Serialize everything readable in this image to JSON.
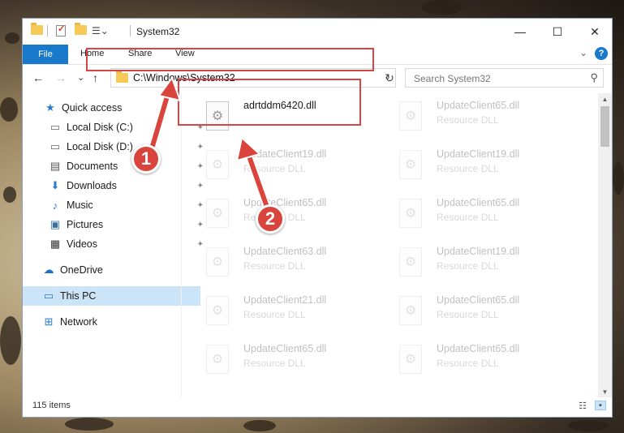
{
  "window": {
    "title": "System32",
    "minimize_glyph": "—",
    "maximize_glyph": "☐",
    "close_glyph": "✕"
  },
  "ribbon": {
    "file_tab": "File",
    "tabs": [
      "Home",
      "Share",
      "View"
    ],
    "help_glyph": "?",
    "expand_glyph": "⌄"
  },
  "address": {
    "path": "C:\\Windows\\System32",
    "dropdown_glyph": "⌄",
    "refresh_glyph": "↻"
  },
  "search": {
    "placeholder": "Search System32",
    "icon": "search-icon"
  },
  "nav_buttons": {
    "back": "←",
    "forward": "→",
    "recent": "⌄",
    "up": "↑"
  },
  "sidebar": {
    "items": [
      {
        "label": "Quick access",
        "icon": "star-icon",
        "glyph": "★",
        "pinned": false,
        "indent": 0
      },
      {
        "label": "Local Disk (C:)",
        "icon": "drive-icon",
        "glyph": "▭",
        "pinned": true,
        "indent": 1
      },
      {
        "label": "Local Disk (D:)",
        "icon": "drive-icon",
        "glyph": "▭",
        "pinned": true,
        "indent": 1
      },
      {
        "label": "Documents",
        "icon": "documents-icon",
        "glyph": "▤",
        "pinned": true,
        "indent": 1
      },
      {
        "label": "Downloads",
        "icon": "downloads-icon",
        "glyph": "⬇",
        "pinned": true,
        "indent": 1
      },
      {
        "label": "Music",
        "icon": "music-icon",
        "glyph": "♪",
        "pinned": true,
        "indent": 1
      },
      {
        "label": "Pictures",
        "icon": "pictures-icon",
        "glyph": "▣",
        "pinned": true,
        "indent": 1
      },
      {
        "label": "Videos",
        "icon": "videos-icon",
        "glyph": "▦",
        "pinned": true,
        "indent": 1
      },
      {
        "label": "OneDrive",
        "icon": "cloud-icon",
        "glyph": "☁",
        "pinned": false,
        "indent": 0
      },
      {
        "label": "This PC",
        "icon": "computer-icon",
        "glyph": "▭",
        "pinned": false,
        "indent": 0,
        "selected": true
      },
      {
        "label": "Network",
        "icon": "network-icon",
        "glyph": "⊞",
        "pinned": false,
        "indent": 0
      }
    ],
    "pin_glyph": "📌"
  },
  "files": [
    {
      "name": "adrtddm6420.dll",
      "type": "",
      "highlighted": true
    },
    {
      "name": "UpdateClient65.dll",
      "type": "Resource DLL"
    },
    {
      "name": "UpdateClient19.dll",
      "type": "Resource DLL"
    },
    {
      "name": "UpdateClient19.dll",
      "type": "Resource DLL"
    },
    {
      "name": "UpdateClient65.dll",
      "type": "Resource DLL"
    },
    {
      "name": "UpdateClient65.dll",
      "type": "Resource DLL"
    },
    {
      "name": "UpdateClient63.dll",
      "type": "Resource DLL"
    },
    {
      "name": "UpdateClient19.dll",
      "type": "Resource DLL"
    },
    {
      "name": "UpdateClient21.dll",
      "type": "Resource DLL"
    },
    {
      "name": "UpdateClient65.dll",
      "type": "Resource DLL"
    },
    {
      "name": "UpdateClient65.dll",
      "type": "Resource DLL"
    },
    {
      "name": "UpdateClient65.dll",
      "type": "Resource DLL"
    }
  ],
  "status": {
    "item_count": "115 items"
  },
  "annotations": {
    "step1": "1",
    "step2": "2",
    "color": "#d9453c"
  },
  "colors": {
    "accent": "#1979ca",
    "highlight_border": "#d64545",
    "selected_bg": "#cce4f7"
  }
}
